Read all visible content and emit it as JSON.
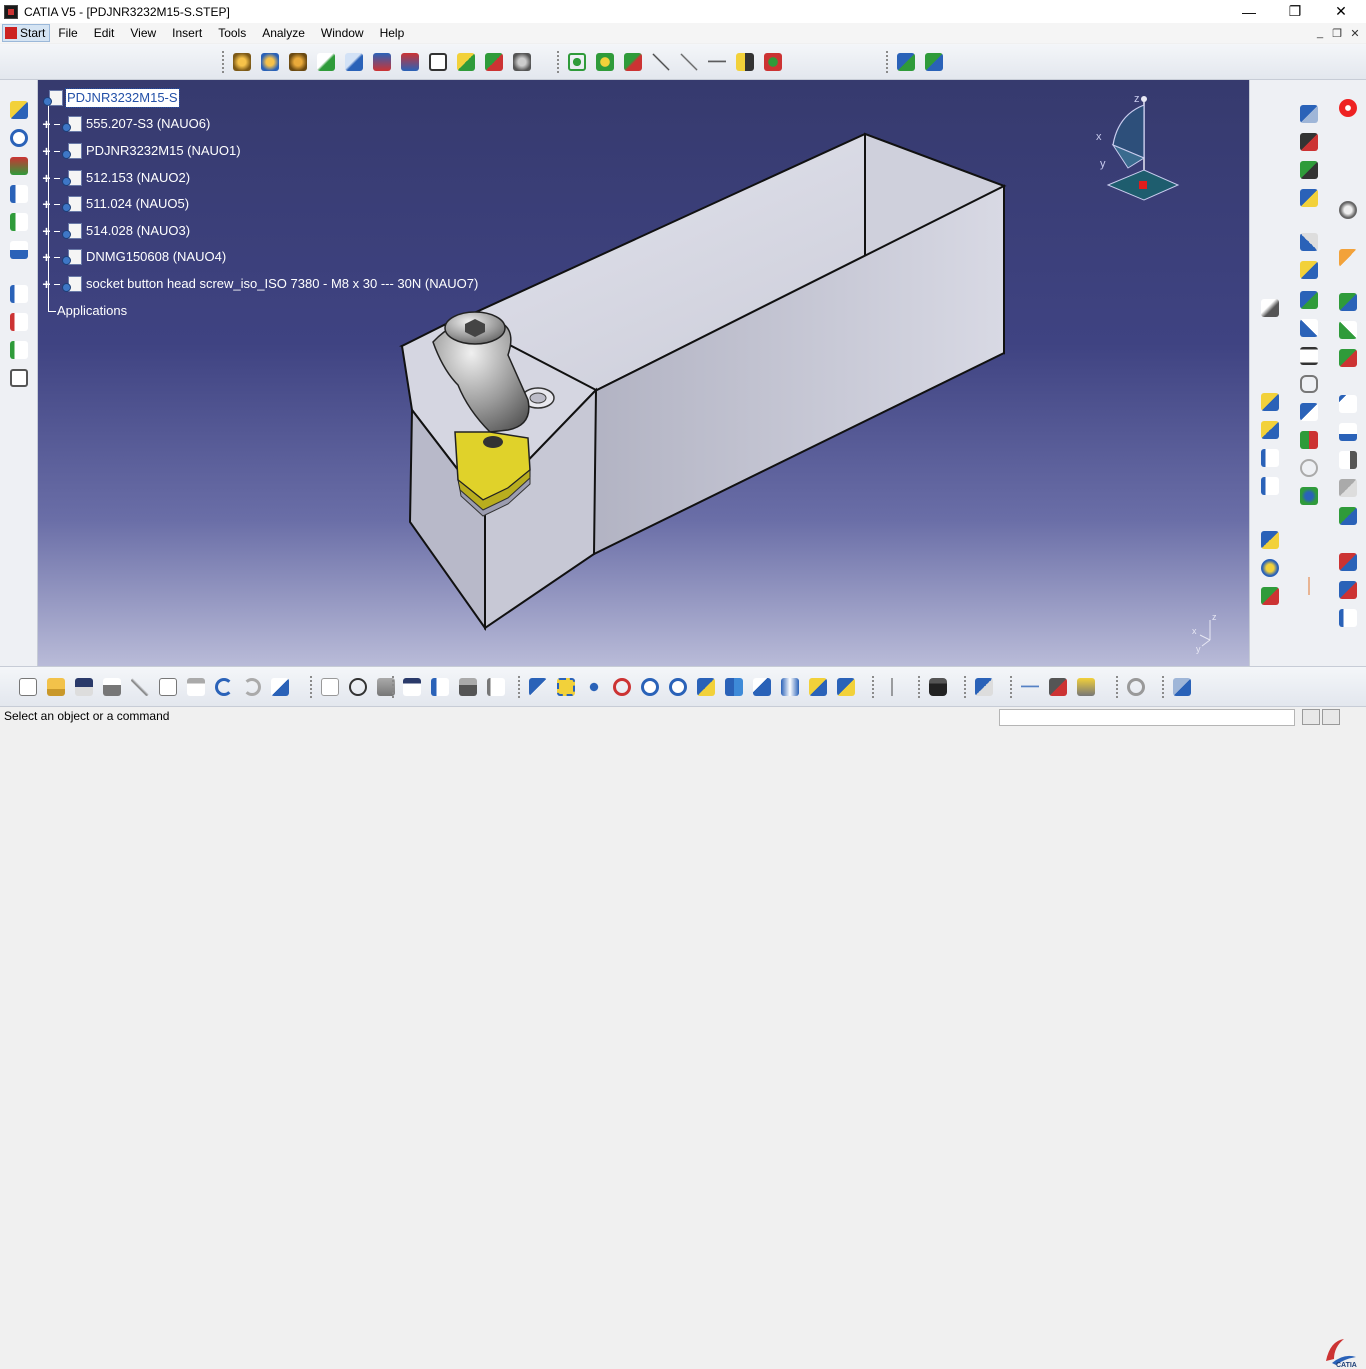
{
  "window": {
    "title": "CATIA V5 - [PDJNR3232M15-S.STEP]",
    "minimize": "—",
    "restore": "❐",
    "close": "✕"
  },
  "menu": {
    "start": "Start",
    "items": [
      "File",
      "Edit",
      "View",
      "Insert",
      "Tools",
      "Analyze",
      "Window",
      "Help"
    ]
  },
  "tree": {
    "root": "PDJNR3232M15-S",
    "children": [
      "555.207-S3 (NAUO6)",
      "PDJNR3232M15 (NAUO1)",
      "512.153 (NAUO2)",
      "511.024 (NAUO5)",
      "514.028 (NAUO3)",
      "DNMG150608 (NAUO4)",
      "socket button head screw_iso_ISO 7380 - M8 x 30 --- 30N (NAUO7)"
    ],
    "applications": "Applications"
  },
  "compass": {
    "x": "x",
    "y": "y",
    "z": "z"
  },
  "axis_triad": {
    "x": "x",
    "y": "y",
    "z": "z"
  },
  "status": {
    "message": "Select an object or a command"
  },
  "colors": {
    "viewport_top": "#363a6e",
    "viewport_bottom": "#b9bbd8",
    "part_face": "#c9cad6",
    "insert_yellow": "#e0d22a",
    "selection_blue": "#2451a8"
  },
  "icons": {
    "close_workbench": "close-red-icon",
    "logo": "catia-logo-icon"
  }
}
